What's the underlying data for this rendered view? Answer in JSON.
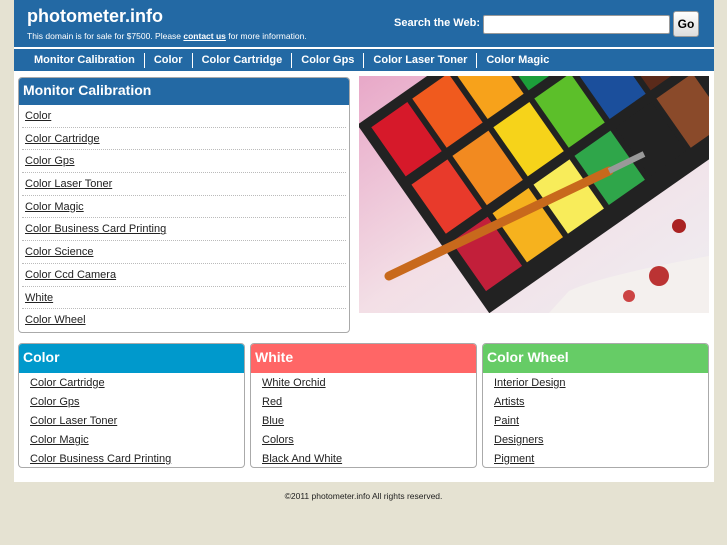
{
  "header": {
    "logo": "photometer.info",
    "sale_prefix": "This domain is for sale for $7500. Please ",
    "contact_link": "contact us",
    "sale_suffix": " for more information.",
    "search_label": "Search the Web:",
    "search_value": "",
    "go_label": "Go"
  },
  "nav": [
    "Monitor Calibration",
    "Color",
    "Color Cartridge",
    "Color Gps",
    "Color Laser Toner",
    "Color Magic"
  ],
  "main_box": {
    "title": "Monitor Calibration",
    "links": [
      "Color",
      "Color Cartridge",
      "Color Gps",
      "Color Laser Toner",
      "Color Magic",
      "Color Business Card Printing",
      "Color Science",
      "Color Ccd Camera",
      "White",
      "Color Wheel"
    ]
  },
  "boxes": [
    {
      "title": "Color",
      "color": "#0099cc",
      "links": [
        "Color Cartridge",
        "Color Gps",
        "Color Laser Toner",
        "Color Magic",
        "Color Business Card Printing"
      ]
    },
    {
      "title": "White",
      "color": "#ff6666",
      "links": [
        "White Orchid",
        "Red",
        "Blue",
        "Colors",
        "Black And White"
      ]
    },
    {
      "title": "Color Wheel",
      "color": "#66cc66",
      "links": [
        "Interior Design",
        "Artists",
        "Paint",
        "Designers",
        "Pigment"
      ]
    }
  ],
  "footer": "©2011 photometer.info All rights reserved."
}
